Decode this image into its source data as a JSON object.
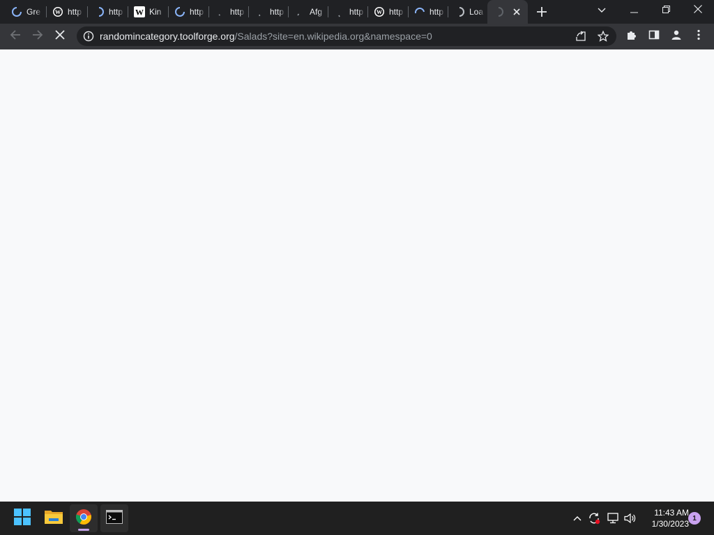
{
  "browser": {
    "tabs": [
      {
        "title": "Gre",
        "favicon": "loading-spinner",
        "active": false
      },
      {
        "title": "http",
        "favicon": "wordpress-icon",
        "active": false
      },
      {
        "title": "http",
        "favicon": "loading-spinner",
        "active": false
      },
      {
        "title": "Kin",
        "favicon": "wikipedia-icon",
        "active": false
      },
      {
        "title": "http",
        "favicon": "loading-spinner",
        "active": false
      },
      {
        "title": "http",
        "favicon": "loading-dot",
        "active": false
      },
      {
        "title": "http",
        "favicon": "loading-dot",
        "active": false
      },
      {
        "title": "Afg",
        "favicon": "loading-dot",
        "active": false
      },
      {
        "title": "http",
        "favicon": "loading-dot",
        "active": false
      },
      {
        "title": "http",
        "favicon": "wordpress-icon",
        "active": false
      },
      {
        "title": "http",
        "favicon": "loading-spinner",
        "active": false
      },
      {
        "title": "Loa",
        "favicon": "loading-spinner",
        "active": false
      },
      {
        "title": "",
        "favicon": "loading-spinner",
        "active": true
      }
    ],
    "new_tab_label": "+",
    "address": {
      "host": "randomincategory.toolforge.org",
      "path": "/Salads?site=en.wikipedia.org&namespace=0"
    },
    "colors": {
      "frame": "#202124",
      "toolbar": "#35363a",
      "page_background": "#f8f9fa",
      "spinner": "#8ab4f8"
    }
  },
  "taskbar": {
    "apps": [
      {
        "name": "start-button",
        "icon": "windows-logo-icon"
      },
      {
        "name": "file-explorer",
        "icon": "folder-icon"
      },
      {
        "name": "chrome",
        "icon": "chrome-icon"
      },
      {
        "name": "terminal",
        "icon": "terminal-icon"
      }
    ],
    "clock": {
      "time": "11:43 AM",
      "date": "1/30/2023"
    },
    "notification_count": "1"
  }
}
